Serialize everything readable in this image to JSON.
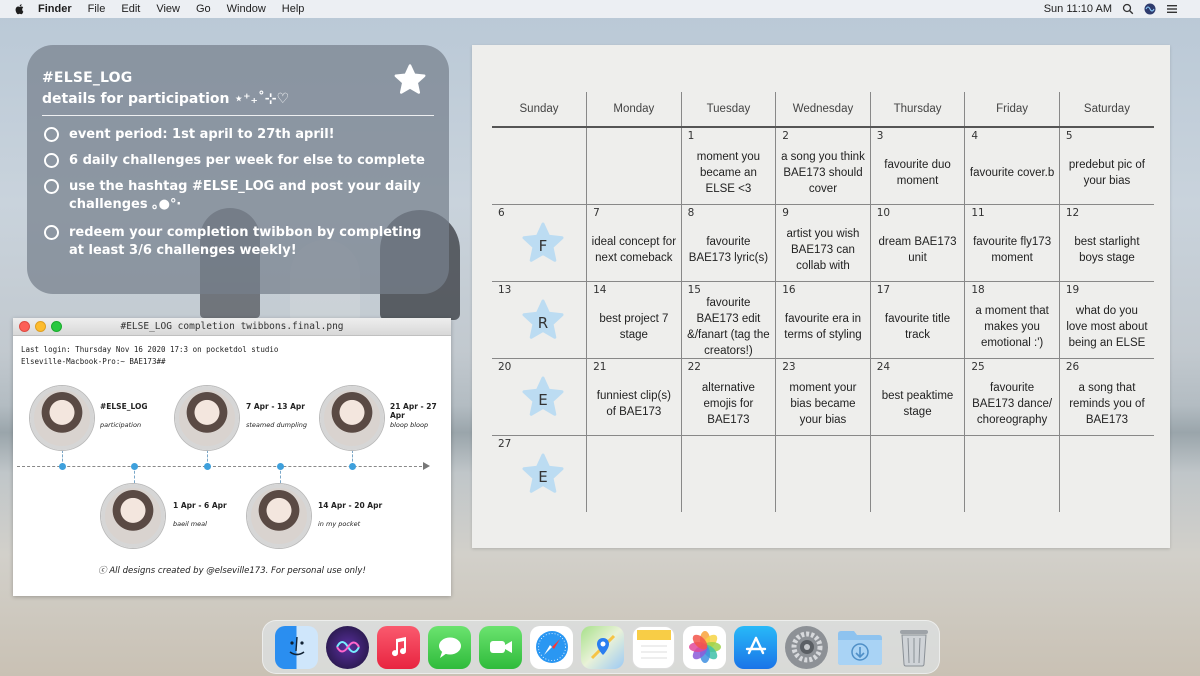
{
  "menubar": {
    "app": "Finder",
    "menus": [
      "File",
      "Edit",
      "View",
      "Go",
      "Window",
      "Help"
    ],
    "clock": "Sun 11:10 AM"
  },
  "info": {
    "title": "#ELSE_LOG",
    "subtitle": "details for participation ⋆⁺₊˚⊹♡",
    "items": [
      "event period: 1st april to 27th april!",
      "6 daily challenges per week for else to complete",
      "use the hashtag #ELSE_LOG and post your daily challenges ｡●°‧",
      "redeem your completion twibbon by completing at least 3/6 challenges weekly!"
    ]
  },
  "twibbon_window": {
    "title": "#ELSE_LOG completion twibbons.final.png",
    "terminal_lines": [
      "Last login: Thursday Nov 16 2020 17:3 on pocketdol studio",
      "Elseville-Macbook-Pro:~ BAE173##"
    ],
    "twibbons": [
      {
        "date": "#ELSE_LOG",
        "name": "participation"
      },
      {
        "date": "7 Apr - 13 Apr",
        "name": "steamed dumpling"
      },
      {
        "date": "21 Apr - 27 Apr",
        "name": "bloop bloop"
      },
      {
        "date": "1 Apr - 6 Apr",
        "name": "baeil meal"
      },
      {
        "date": "14 Apr - 20 Apr",
        "name": "in my pocket"
      }
    ],
    "credit": "ⓒ All designs created by @elseville173. For personal use only!"
  },
  "calendar": {
    "days": [
      "Sunday",
      "Monday",
      "Tuesday",
      "Wednesday",
      "Thursday",
      "Friday",
      "Saturday"
    ],
    "weeks": [
      [
        {
          "num": "",
          "text": ""
        },
        {
          "num": "",
          "text": ""
        },
        {
          "num": "1",
          "text": "moment you became an ELSE <3"
        },
        {
          "num": "2",
          "text": "a song you think BAE173 should cover"
        },
        {
          "num": "3",
          "text": "favourite duo moment"
        },
        {
          "num": "4",
          "text": "favourite cover.b"
        },
        {
          "num": "5",
          "text": "predebut pic of your bias"
        }
      ],
      [
        {
          "num": "6",
          "letter": "F"
        },
        {
          "num": "7",
          "text": "ideal concept for next comeback"
        },
        {
          "num": "8",
          "text": "favourite BAE173 lyric(s)"
        },
        {
          "num": "9",
          "text": "artist you wish BAE173 can collab with"
        },
        {
          "num": "10",
          "text": "dream BAE173 unit"
        },
        {
          "num": "11",
          "text": "favourite fly173 moment"
        },
        {
          "num": "12",
          "text": "best starlight boys stage"
        }
      ],
      [
        {
          "num": "13",
          "letter": "R"
        },
        {
          "num": "14",
          "text": "best project 7 stage"
        },
        {
          "num": "15",
          "text": "favourite BAE173 edit &/fanart (tag the creators!)"
        },
        {
          "num": "16",
          "text": "favourite era in terms of styling"
        },
        {
          "num": "17",
          "text": "favourite title track"
        },
        {
          "num": "18",
          "text": "a moment that makes you emotional :')"
        },
        {
          "num": "19",
          "text": "what do you love most about being an ELSE"
        }
      ],
      [
        {
          "num": "20",
          "letter": "E"
        },
        {
          "num": "21",
          "text": "funniest clip(s) of BAE173"
        },
        {
          "num": "22",
          "text": "alternative emojis for BAE173"
        },
        {
          "num": "23",
          "text": "moment your bias became your bias"
        },
        {
          "num": "24",
          "text": "best peaktime stage"
        },
        {
          "num": "25",
          "text": "favourite BAE173 dance/ choreography"
        },
        {
          "num": "26",
          "text": "a song that reminds you of BAE173"
        }
      ],
      [
        {
          "num": "27",
          "letter": "E"
        },
        {
          "num": "",
          "text": ""
        },
        {
          "num": "",
          "text": ""
        },
        {
          "num": "",
          "text": ""
        },
        {
          "num": "",
          "text": ""
        },
        {
          "num": "",
          "text": ""
        },
        {
          "num": "",
          "text": ""
        }
      ]
    ]
  },
  "dock": {
    "apps": [
      "finder-icon",
      "siri-icon",
      "music-icon",
      "messages-icon",
      "facetime-icon",
      "safari-icon",
      "maps-icon",
      "notes-icon",
      "photos-icon",
      "app-store-icon",
      "system-preferences-icon",
      "downloads-folder-icon",
      "trash-icon"
    ]
  },
  "colors": {
    "star": "#bcdcf2",
    "panel": "#76808c"
  }
}
